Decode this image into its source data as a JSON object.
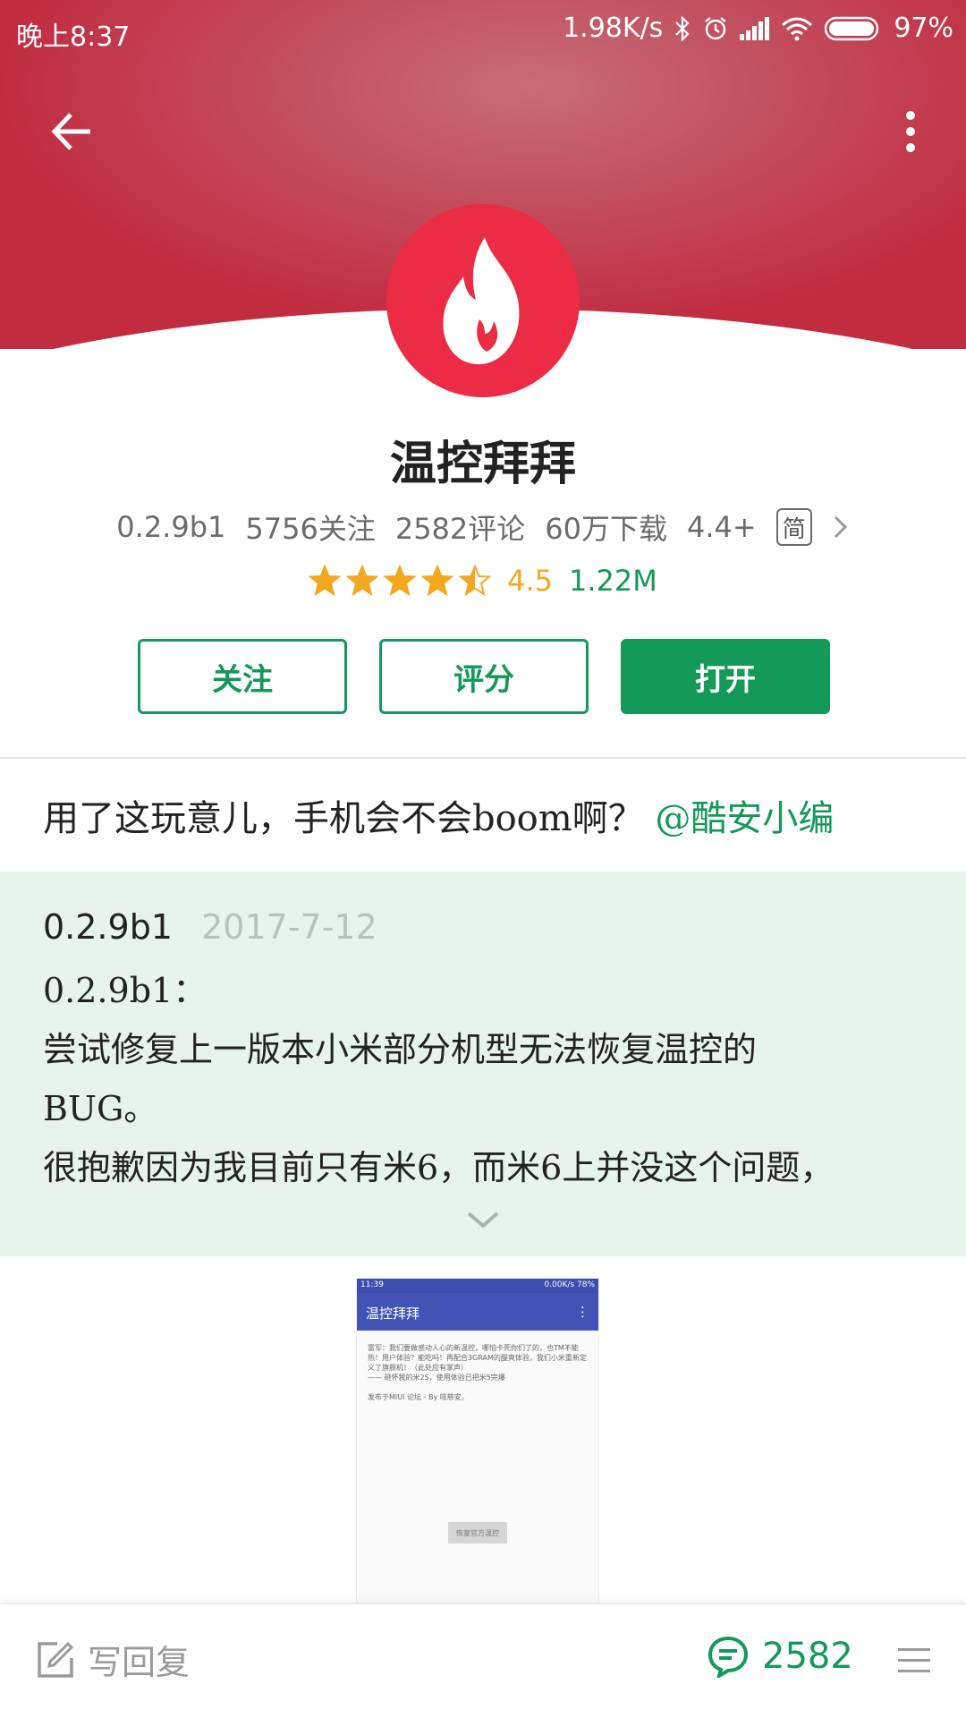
{
  "status_bar": {
    "time": "晚上8:37",
    "network_speed": "1.98K/s",
    "battery": "97%",
    "icons": [
      "bluetooth-icon",
      "alarm-icon",
      "signal-icon",
      "wifi-icon",
      "battery-icon"
    ]
  },
  "header": {
    "back_icon": "arrow-left-icon",
    "more_icon": "more-vertical-icon",
    "app_icon": "flame-icon"
  },
  "app": {
    "name": "温控拜拜",
    "version": "0.2.9b1",
    "follows": "5756关注",
    "comments": "2582评论",
    "downloads": "60万下载",
    "android": "4.4+",
    "lang_badge": "简",
    "rating_score": "4.5",
    "rating_value": 4.5,
    "rating_max": 5,
    "size": "1.22M"
  },
  "actions": {
    "follow": "关注",
    "rate": "评分",
    "open": "打开"
  },
  "tagline": {
    "text": "用了这玩意儿，手机会不会boom啊？",
    "mention": "@酷安小编"
  },
  "changelog": {
    "version": "0.2.9b1",
    "date": "2017-7-12",
    "body": "0.2.9b1：\n尝试修复上一版本小米部分机型无法恢复温控的\nBUG。\n很抱歉因为我目前只有米6，而米6上并没这个问题，"
  },
  "screenshot": {
    "status_time": "11:39",
    "status_right": "0.00K/s 78%",
    "title": "温控拜拜",
    "text": "雷军：我们要做感动人心的新温控，哪怕卡死你们了的，也TM不能热！用户体验？能吃吗！再配合3GRAM的醍爽体验，我们小米重新定义了旗舰机！（此处应有掌声）\n—— 砸怀我的米2S，使用体验已把米5完爆\n\n发布于MIUI 论坛 - By 吱慈安。",
    "button": "恢复官方温控"
  },
  "bottom_bar": {
    "reply": "写回复",
    "comment_count": "2582"
  },
  "colors": {
    "accent": "#139958",
    "header": "#c12c41",
    "icon_bg": "#ec2b44",
    "star": "#f2a81f",
    "changelog_bg": "#e6f4ec"
  }
}
